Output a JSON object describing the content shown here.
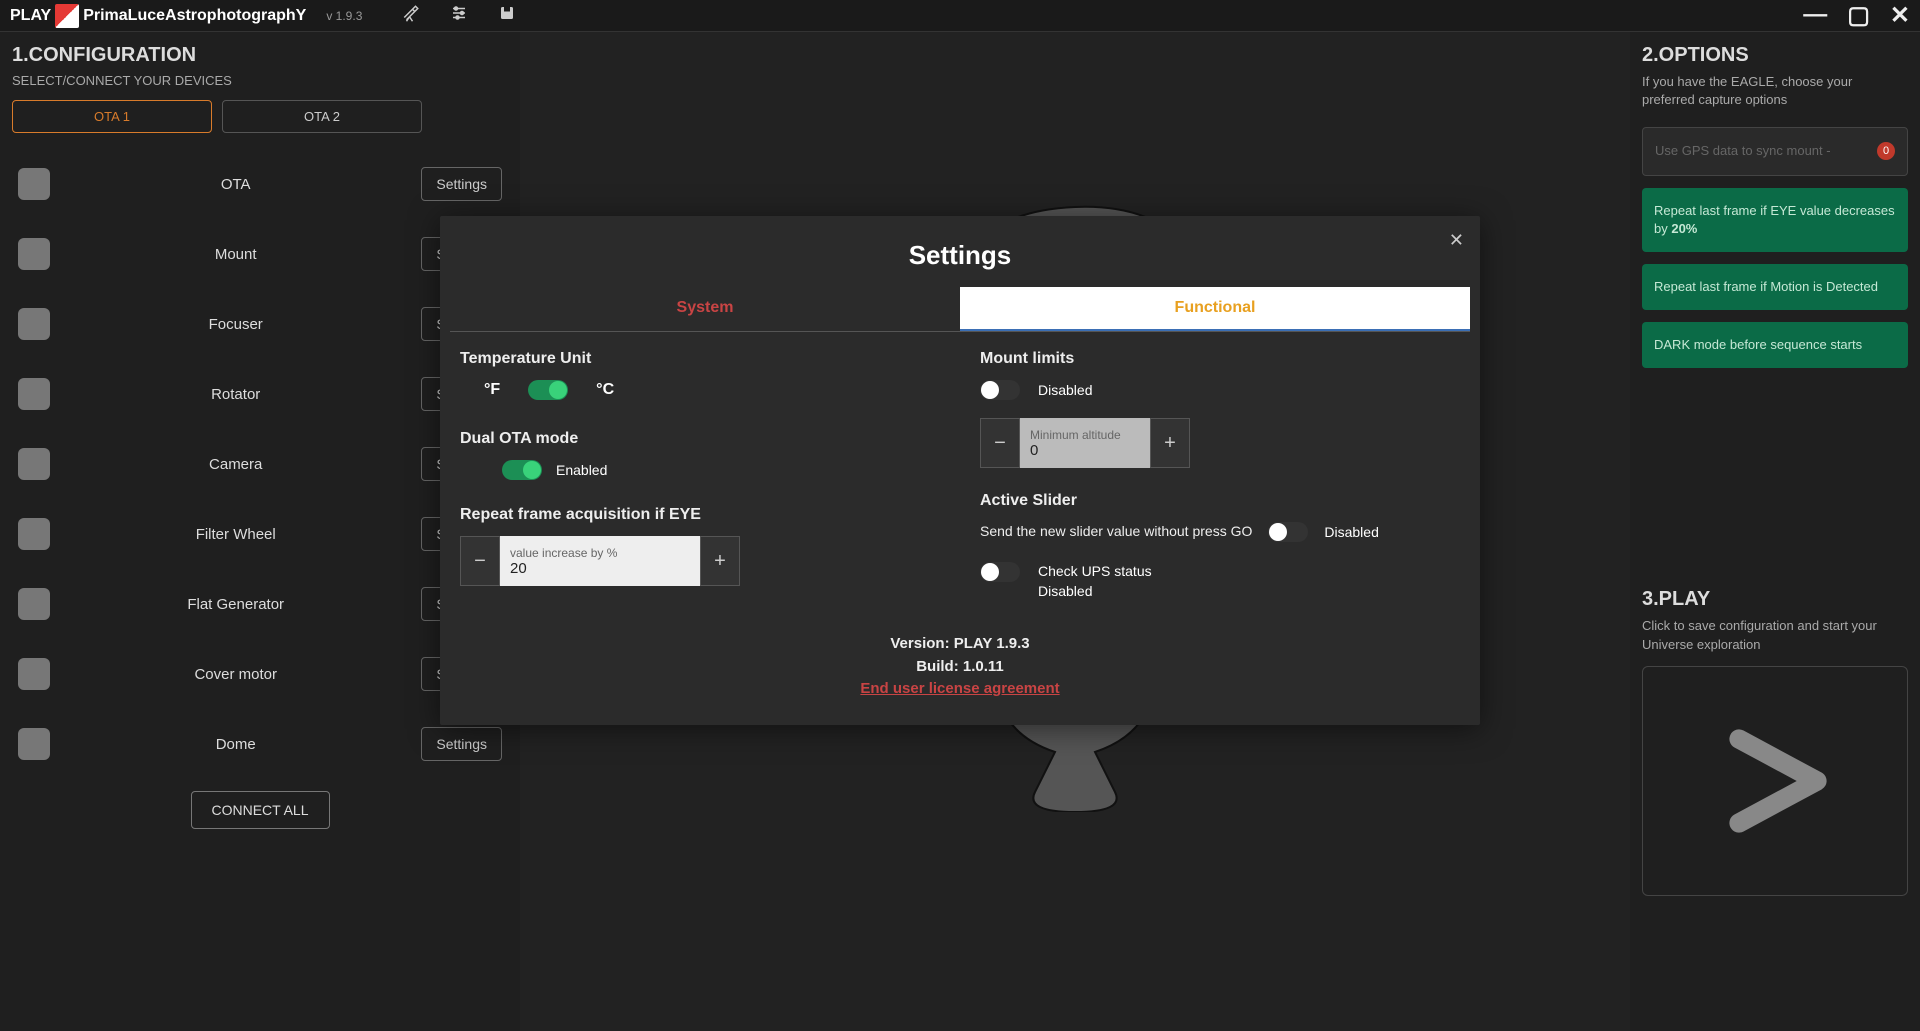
{
  "titlebar": {
    "play": "PLAY",
    "brand": "PrimaLuceAstrophotographY",
    "version": "v 1.9.3"
  },
  "left": {
    "title": "1.CONFIGURATION",
    "subtitle": "SELECT/CONNECT YOUR DEVICES",
    "ota1": "OTA 1",
    "ota2": "OTA 2",
    "devices": [
      {
        "name": "OTA",
        "btn": "Settings"
      },
      {
        "name": "Mount",
        "btn": "Settings"
      },
      {
        "name": "Focuser",
        "btn": "Settings"
      },
      {
        "name": "Rotator",
        "btn": "Settings"
      },
      {
        "name": "Camera",
        "btn": "Settings"
      },
      {
        "name": "Filter Wheel",
        "btn": "Settings"
      },
      {
        "name": "Flat Generator",
        "btn": "Settings"
      },
      {
        "name": "Cover motor",
        "btn": "Settings"
      },
      {
        "name": "Dome",
        "btn": "Settings"
      }
    ],
    "connect_all": "CONNECT ALL"
  },
  "right": {
    "title": "2.OPTIONS",
    "subtitle": "If you have the EAGLE, choose your preferred capture options",
    "gps": "Use GPS data to sync mount  -",
    "gps_badge": "0",
    "opt1": "Repeat last frame if EYE value decreases by ",
    "opt1_bold": "20%",
    "opt2": "Repeat last frame if Motion is Detected",
    "opt3": "DARK mode before sequence starts",
    "play_title": "3.PLAY",
    "play_sub": "Click to save configuration and start your Universe exploration"
  },
  "modal": {
    "title": "Settings",
    "tab_system": "System",
    "tab_functional": "Functional",
    "temp_label": "Temperature Unit",
    "temp_f": "°F",
    "temp_c": "°C",
    "dual_label": "Dual OTA mode",
    "dual_enabled": "Enabled",
    "repeat_label": "Repeat frame acquisition if EYE",
    "repeat_ph": "value increase by %",
    "repeat_val": "20",
    "mount_label": "Mount limits",
    "mount_disabled": "Disabled",
    "alt_ph": "Minimum altitude",
    "alt_val": "0",
    "active_label": "Active Slider",
    "active_desc": "Send the new slider value without press GO",
    "active_disabled": "Disabled",
    "ups_line1": "Check UPS status",
    "ups_line2": "Disabled",
    "version": "Version: PLAY 1.9.3",
    "build": "Build: 1.0.11",
    "eula": "End user license agreement"
  }
}
